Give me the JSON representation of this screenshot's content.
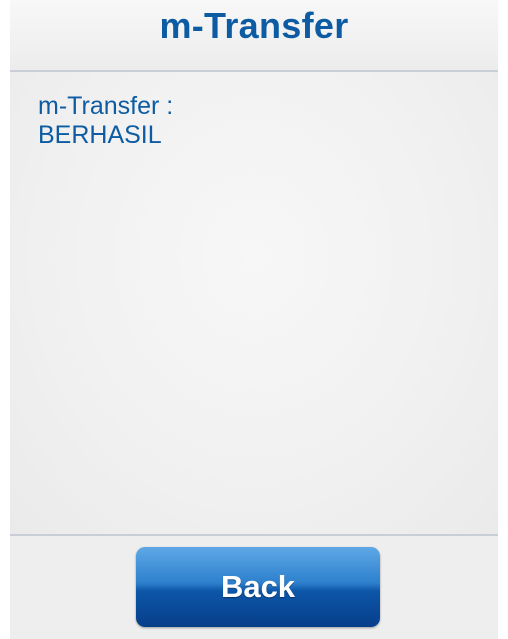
{
  "header": {
    "title": "m-Transfer"
  },
  "message": {
    "line1": "m-Transfer :",
    "line2": "BERHASIL"
  },
  "footer": {
    "back_label": "Back"
  },
  "colors": {
    "accent": "#0d5ca3",
    "button_top": "#5fa8e6",
    "button_bottom": "#073e8a",
    "background": "#eeeeee"
  }
}
